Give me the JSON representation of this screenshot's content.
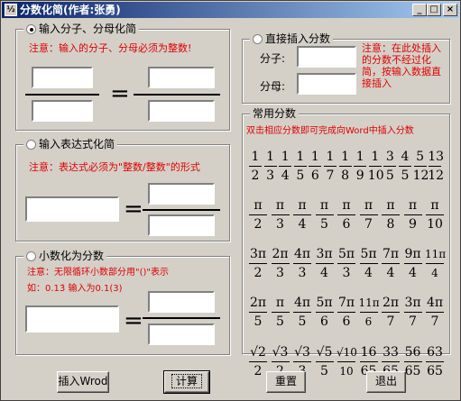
{
  "window": {
    "title": "分数化简(作者:张勇)",
    "app_icon": "app-icon",
    "min_label": "_",
    "max_label": "□",
    "close_label": "×"
  },
  "group1": {
    "legend": "输入分子、分母化简",
    "note": "注意：输入的分子、分母必须为整数!",
    "left_numerator": "",
    "left_denominator": "",
    "right_numerator": "",
    "right_denominator": "",
    "equals": "="
  },
  "group2": {
    "legend": "输入表达式化简",
    "note": "注意：表达式必须为\"整数/整数\"的形式",
    "expression": "",
    "right_numerator": "",
    "right_denominator": "",
    "equals": "="
  },
  "group3": {
    "legend": "小数化为分数",
    "note_line1": "注意：无限循环小数部分用\"()\"表示",
    "note_line2": "如：0.13̇ 输入为0.1(3)",
    "decimal": "",
    "right_numerator": "",
    "right_denominator": "",
    "equals": "="
  },
  "direct": {
    "legend": "直接插入分数",
    "numerator_label": "分子:",
    "denominator_label": "分母:",
    "numerator": "",
    "denominator": "",
    "note": "注意：在此处插入的分数不经过化简，按输入数据直接插入"
  },
  "common": {
    "legend": "常用分数",
    "note": "双击相应分数即可完成向Word中插入分数",
    "rows": [
      [
        [
          "1",
          "2"
        ],
        [
          "1",
          "3"
        ],
        [
          "1",
          "4"
        ],
        [
          "1",
          "5"
        ],
        [
          "1",
          "6"
        ],
        [
          "1",
          "7"
        ],
        [
          "1",
          "8"
        ],
        [
          "1",
          "9"
        ],
        [
          "1",
          "10"
        ],
        [
          "3",
          "5"
        ],
        [
          "4",
          "5"
        ],
        [
          "5",
          "12"
        ],
        [
          "13",
          "12"
        ]
      ],
      [
        [
          "π",
          "2"
        ],
        [
          "π",
          "3"
        ],
        [
          "π",
          "4"
        ],
        [
          "π",
          "5"
        ],
        [
          "π",
          "6"
        ],
        [
          "π",
          "7"
        ],
        [
          "π",
          "8"
        ],
        [
          "π",
          "9"
        ],
        [
          "π",
          "10"
        ]
      ],
      [
        [
          "3π",
          "2"
        ],
        [
          "2π",
          "3"
        ],
        [
          "4π",
          "3"
        ],
        [
          "3π",
          "4"
        ],
        [
          "5π",
          "3"
        ],
        [
          "5π",
          "4"
        ],
        [
          "7π",
          "4"
        ],
        [
          "9π",
          "4"
        ],
        [
          "11π",
          "4"
        ]
      ],
      [
        [
          "2π",
          "5"
        ],
        [
          "π",
          "5"
        ],
        [
          "4π",
          "5"
        ],
        [
          "5π",
          "6"
        ],
        [
          "7π",
          "6"
        ],
        [
          "11π",
          "6"
        ],
        [
          "2π",
          "7"
        ],
        [
          "3π",
          "7"
        ],
        [
          "4π",
          "7"
        ]
      ],
      [
        [
          "√2",
          "2"
        ],
        [
          "√3",
          "2"
        ],
        [
          "√3",
          "3"
        ],
        [
          "√5",
          "5"
        ],
        [
          "√10",
          "10"
        ],
        [
          "16",
          "65"
        ],
        [
          "33",
          "65"
        ],
        [
          "56",
          "65"
        ],
        [
          "63",
          "65"
        ]
      ]
    ]
  },
  "buttons": {
    "insert_word": "插入Wrod",
    "compute": "计算",
    "reset": "重置",
    "exit": "退出"
  }
}
